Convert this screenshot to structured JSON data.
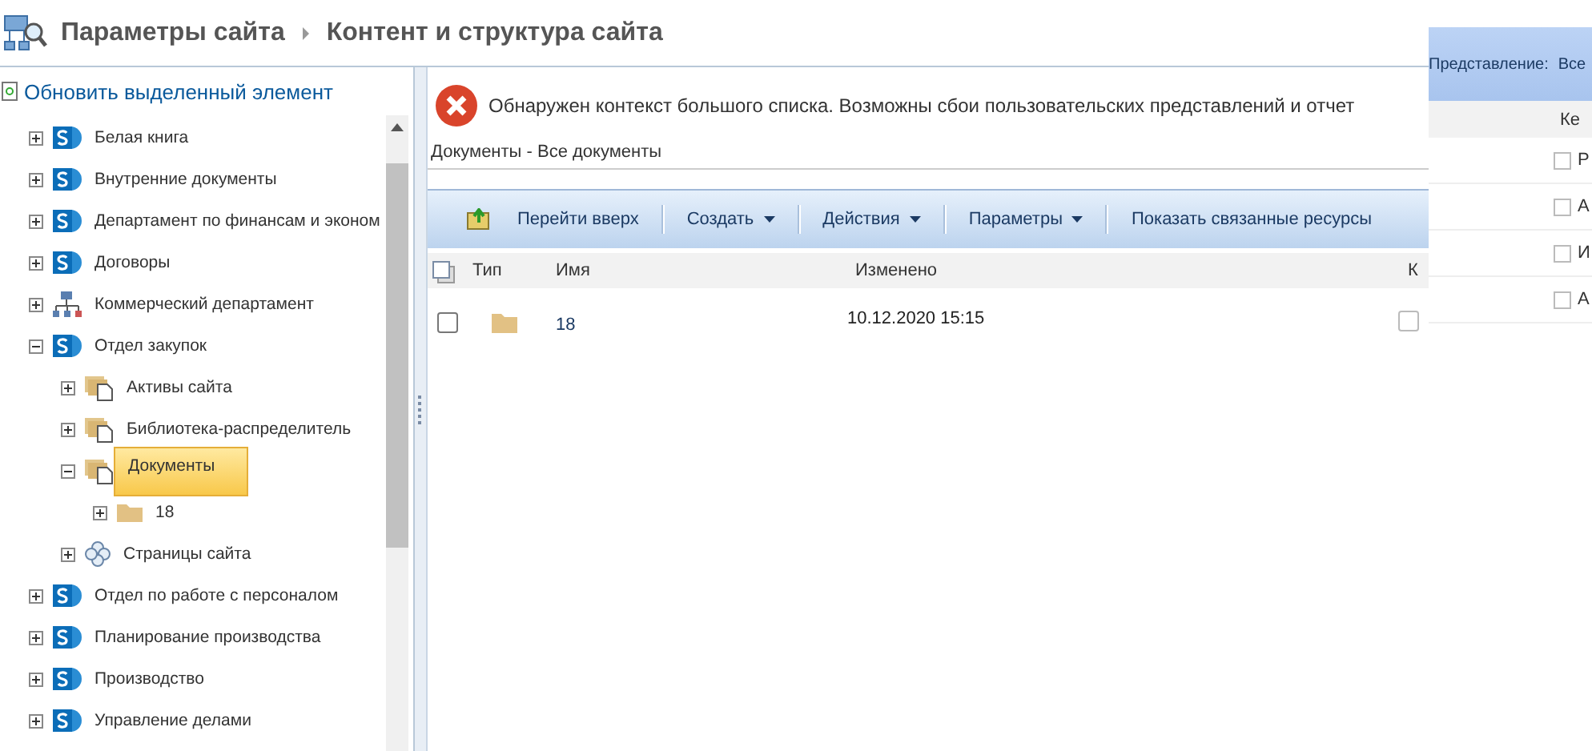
{
  "breadcrumb": [
    "Параметры сайта",
    "Контент и структура сайта"
  ],
  "refresh_link": "Обновить выделенный элемент",
  "tree": [
    {
      "label": "Белая книга",
      "kind": "site",
      "expanded": false,
      "selected": false
    },
    {
      "label": "Внутренние документы",
      "kind": "site",
      "expanded": false,
      "selected": false
    },
    {
      "label": "Департамент по финансам и эконом",
      "kind": "site",
      "expanded": false,
      "selected": false
    },
    {
      "label": "Договоры",
      "kind": "site",
      "expanded": false,
      "selected": false
    },
    {
      "label": "Коммерческий департамент",
      "kind": "network",
      "expanded": false,
      "selected": false
    },
    {
      "label": "Отдел закупок",
      "kind": "site",
      "expanded": true,
      "selected": false,
      "children": [
        {
          "label": "Активы сайта",
          "kind": "library",
          "expanded": false,
          "selected": false
        },
        {
          "label": "Библиотека-распределитель",
          "kind": "library",
          "expanded": false,
          "selected": false
        },
        {
          "label": "Документы",
          "kind": "library",
          "expanded": true,
          "selected": true,
          "children": [
            {
              "label": "18",
              "kind": "folder",
              "expanded": false,
              "selected": false
            }
          ]
        },
        {
          "label": "Страницы сайта",
          "kind": "pages",
          "expanded": false,
          "selected": false
        }
      ]
    },
    {
      "label": "Отдел по работе с персоналом",
      "kind": "site",
      "expanded": false,
      "selected": false
    },
    {
      "label": "Планирование производства",
      "kind": "site",
      "expanded": false,
      "selected": false
    },
    {
      "label": "Производство",
      "kind": "site",
      "expanded": false,
      "selected": false
    },
    {
      "label": "Управление делами",
      "kind": "site",
      "expanded": false,
      "selected": false
    }
  ],
  "error_message": "Обнаружен контекст большого списка. Возможны сбои пользовательских представлений и отчет",
  "list_title": "Документы - Все документы",
  "toolbar": [
    {
      "label": "Перейти вверх",
      "kind": "up"
    },
    {
      "label": "Создать",
      "kind": "menu"
    },
    {
      "label": "Действия",
      "kind": "menu"
    },
    {
      "label": "Параметры",
      "kind": "menu"
    },
    {
      "label": "Показать связанные ресурсы",
      "kind": "plain"
    }
  ],
  "table": {
    "columns": [
      "Тип",
      "Имя",
      "Изменено",
      "К"
    ],
    "rows": [
      {
        "checked": false,
        "name": "18",
        "modified": "10.12.2020 15:15",
        "column_5_checked": false
      }
    ]
  },
  "side_window": {
    "view_label": "Представление:",
    "view_value": "Все",
    "column": "Ке",
    "rows": [
      {
        "text": "Р",
        "checked": false
      },
      {
        "text": "А",
        "checked": false
      },
      {
        "text": "И",
        "checked": false
      },
      {
        "text": "А",
        "checked": false
      }
    ]
  }
}
